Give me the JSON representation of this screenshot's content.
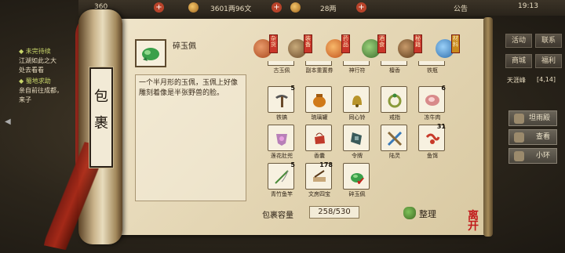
{
  "topbar": {
    "stamina": "360",
    "silver": "3601两96文",
    "coins": "28两",
    "announce": "公告",
    "time": "19:13"
  },
  "quests": [
    {
      "title": "◆ 未完待续",
      "desc1": "江湖如此之大",
      "desc2": "处去看看"
    },
    {
      "title": "◆ 蜀地求助",
      "desc1": "亲自前往成都，",
      "desc2": "来子"
    }
  ],
  "right_panel": {
    "buttons": [
      "活动",
      "联系",
      "商城",
      "福利"
    ],
    "location": "天涯峰",
    "coord": "[4,14]",
    "actions": [
      "坦雨殿",
      "查看",
      "小环"
    ]
  },
  "bag": {
    "title_glyph_1": "包",
    "title_glyph_2": "裹",
    "selected_name": "碎玉佩",
    "description": "一个半月形的玉佩，玉佩上好像雕刻着像是半张野兽的脸。",
    "capacity_label": "包裹容量",
    "capacity_value": "258/530",
    "sort_label": "整理",
    "close_glyph_1": "离",
    "close_glyph_2": "开"
  },
  "categories": [
    {
      "name": "杂货",
      "icon": "sundries-icon",
      "color": "#c8663c"
    },
    {
      "name": "装备",
      "icon": "equipment-icon",
      "color": "#9a7a4a"
    },
    {
      "name": "药品",
      "icon": "medicine-icon",
      "color": "#e08a3a"
    },
    {
      "name": "酒食",
      "icon": "food-icon",
      "color": "#5e9a4a"
    },
    {
      "name": "秘籍",
      "icon": "manual-icon",
      "color": "#7a5a3a"
    },
    {
      "name": "材料",
      "icon": "material-icon",
      "color": "#4a8ac0"
    }
  ],
  "partial_row": [
    "古玉佩",
    "副本重置券",
    "神行符",
    "檀香",
    "铁瓶"
  ],
  "items": [
    {
      "name": "铁镐",
      "count": "5",
      "icon": "pickaxe-icon",
      "color": "#5a5a5a"
    },
    {
      "name": "琉璃罐",
      "count": "",
      "icon": "jar-icon",
      "color": "#d07a1a"
    },
    {
      "name": "同心铃",
      "count": "",
      "icon": "bell-icon",
      "color": "#b8942a"
    },
    {
      "name": "戒指",
      "count": "",
      "icon": "ring-icon",
      "color": "#8a9a3a"
    },
    {
      "name": "冻牛肉",
      "count": "6",
      "icon": "meat-icon",
      "color": "#d88a8a"
    },
    {
      "name": "莲花肚兜",
      "count": "",
      "icon": "bib-icon",
      "color": "#b880b8"
    },
    {
      "name": "香囊",
      "count": "",
      "icon": "sachet-icon",
      "color": "#c03a2a"
    },
    {
      "name": "令牌",
      "count": "",
      "icon": "token-icon",
      "color": "#3a5a5a"
    },
    {
      "name": "陆灵",
      "count": "",
      "icon": "blade-icon",
      "color": "#3a7ab8"
    },
    {
      "name": "鱼饵",
      "count": "31",
      "icon": "worm-icon",
      "color": "#c83a2a"
    },
    {
      "name": "青竹鱼竿",
      "count": "5",
      "icon": "fishing-rod-icon",
      "color": "#4a8a3a"
    },
    {
      "name": "文房四宝",
      "count": "178",
      "icon": "stationery-icon",
      "color": "#8a6a3a"
    },
    {
      "name": "碎玉佩",
      "count": "",
      "icon": "jade-pendant-icon",
      "color": "#3aa04a",
      "selected": true
    }
  ]
}
